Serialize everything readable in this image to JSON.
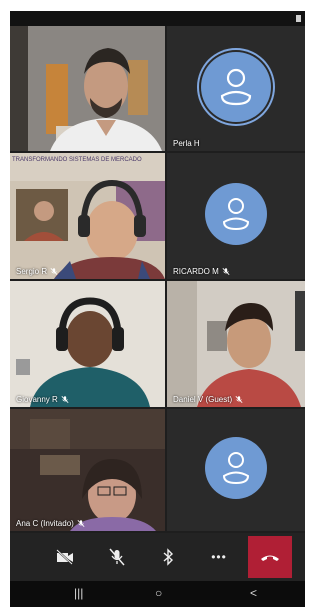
{
  "participants": [
    {
      "name": "",
      "muted": false,
      "has_video": true
    },
    {
      "name": "Perla H",
      "muted": false,
      "has_video": false,
      "selected": true
    },
    {
      "name": "Sergio R",
      "muted": true,
      "has_video": true
    },
    {
      "name": "RICARDO M",
      "muted": true,
      "has_video": false
    },
    {
      "name": "Giovanny R",
      "muted": true,
      "has_video": true
    },
    {
      "name": "Daniel V (Guest)",
      "muted": true,
      "has_video": true
    },
    {
      "name": "Ana C (Invitado)",
      "muted": true,
      "has_video": true
    },
    {
      "name": "",
      "muted": false,
      "has_video": false
    }
  ],
  "banner_text": "TRANSFORMANDO SISTEMAS DE MERCADO",
  "toolbar": {
    "icons": [
      "camera-off-icon",
      "mic-off-icon",
      "bluetooth-icon",
      "more-icon",
      "hang-up-icon"
    ],
    "more_label": "•••"
  },
  "navbar": {
    "recents_label": "|||",
    "home_label": "○",
    "back_label": "<"
  },
  "colors": {
    "avatar": "#6f9ad3",
    "hangup": "#b01f35",
    "tile_empty": "#2a2a2a",
    "toolbar": "#232323"
  }
}
